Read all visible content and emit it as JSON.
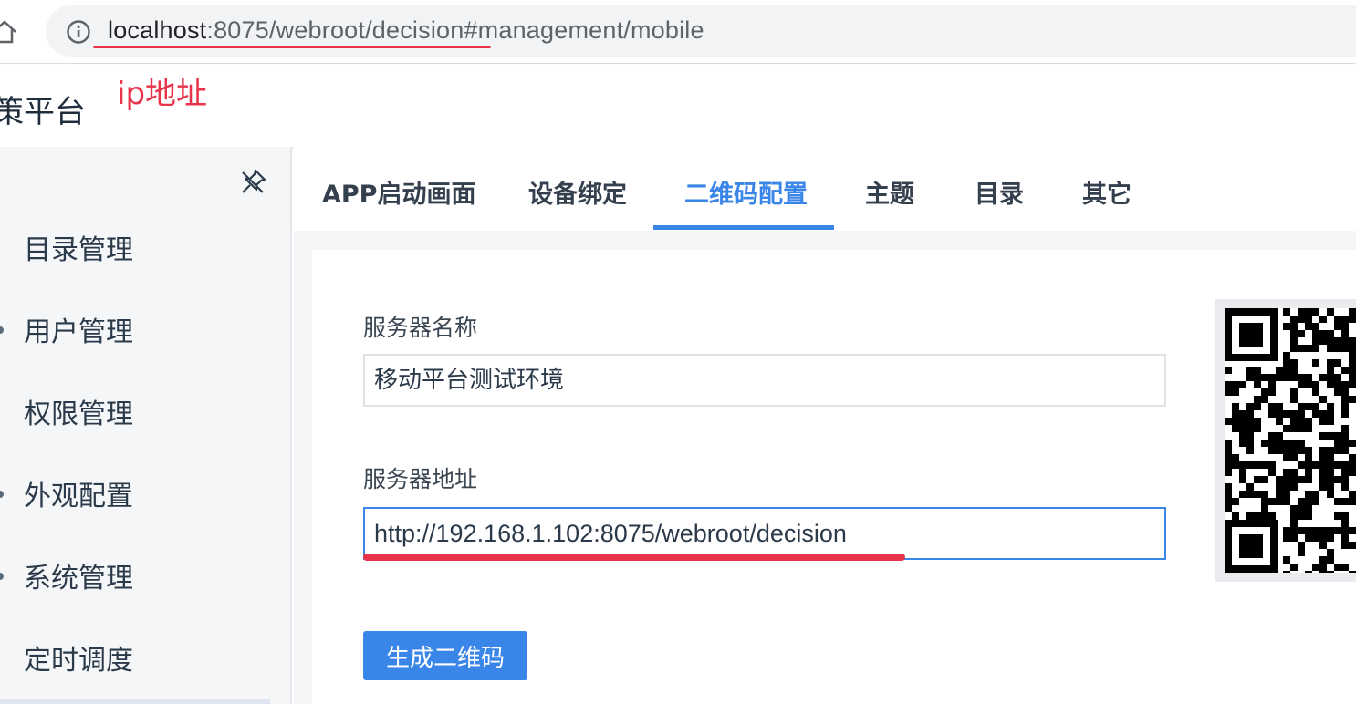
{
  "browser": {
    "url_host": "localhost",
    "url_rest": ":8075/webroot/decision#management/mobile"
  },
  "annotation": {
    "ip_label": "ip地址"
  },
  "app": {
    "title": "策平台"
  },
  "sidebar": {
    "items": [
      {
        "label": "目录管理"
      },
      {
        "label": "用户管理"
      },
      {
        "label": "权限管理"
      },
      {
        "label": "外观配置"
      },
      {
        "label": "系统管理"
      },
      {
        "label": "定时调度"
      }
    ]
  },
  "tabs": [
    {
      "label": "APP启动画面"
    },
    {
      "label": "设备绑定"
    },
    {
      "label": "二维码配置",
      "active": true
    },
    {
      "label": "主题"
    },
    {
      "label": "目录"
    },
    {
      "label": "其它"
    }
  ],
  "form": {
    "server_name_label": "服务器名称",
    "server_name_value": "移动平台测试环境",
    "server_addr_label": "服务器地址",
    "server_addr_value": "http://192.168.1.102:8075/webroot/decision",
    "generate_button": "生成二维码"
  },
  "colors": {
    "accent": "#3a86e8",
    "annotation": "#e8334a"
  }
}
